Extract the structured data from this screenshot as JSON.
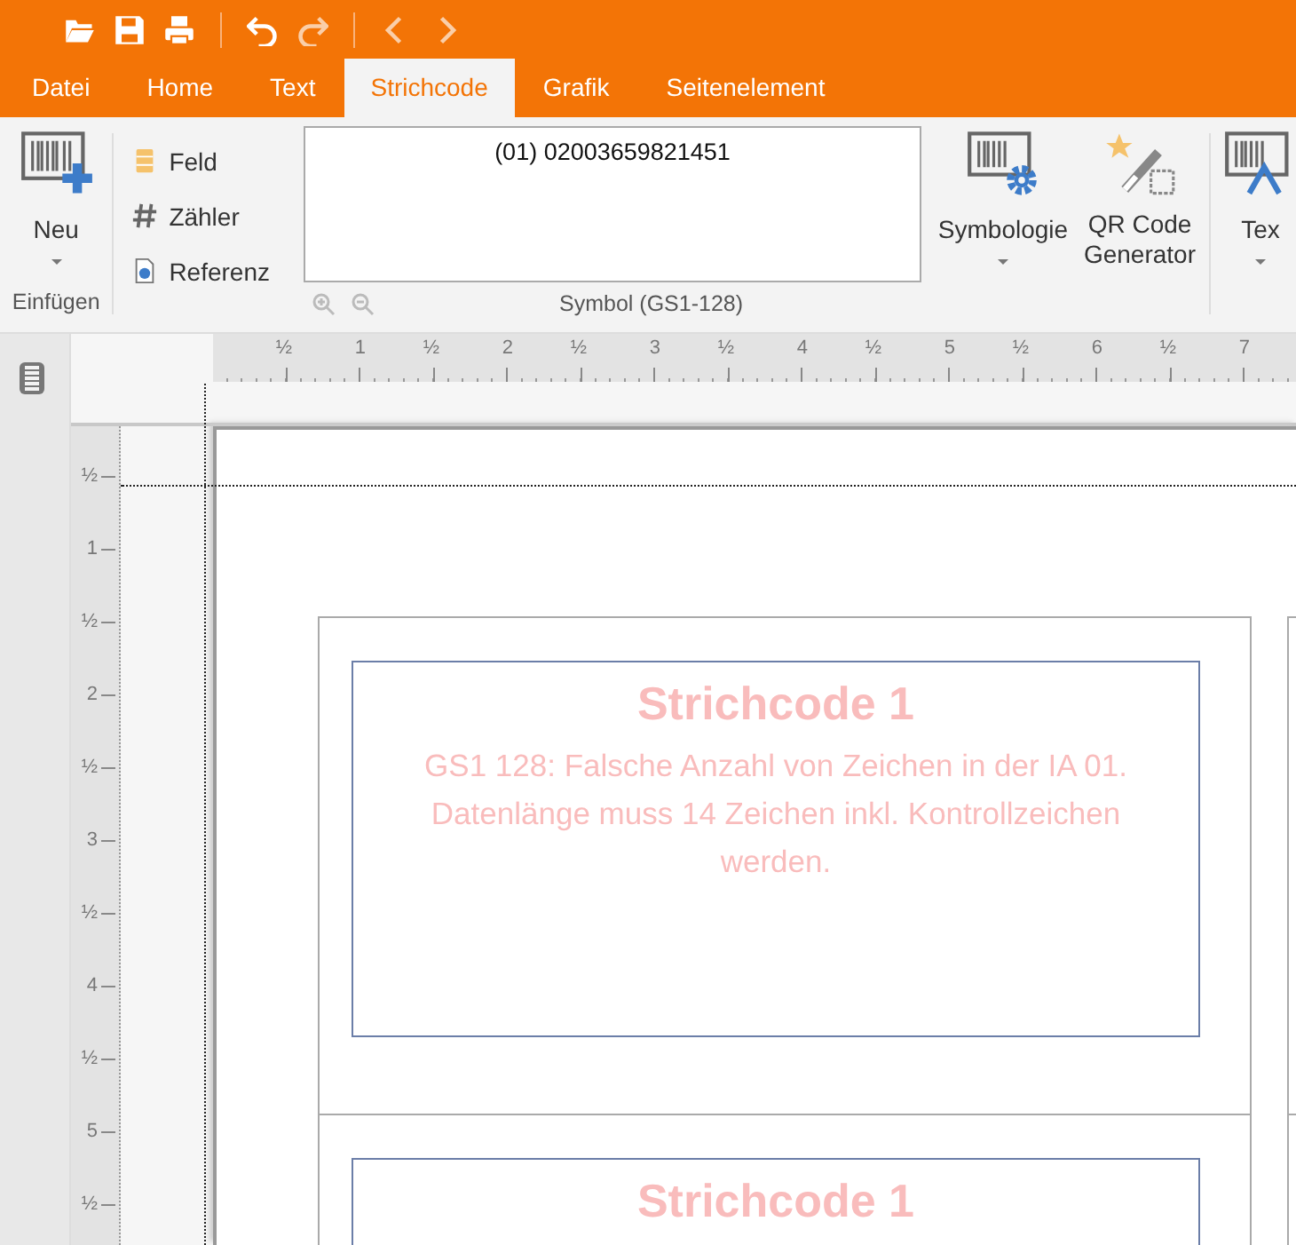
{
  "tabs": [
    {
      "label": "Datei",
      "selected": false
    },
    {
      "label": "Home",
      "selected": false
    },
    {
      "label": "Text",
      "selected": false
    },
    {
      "label": "Strichcode",
      "selected": true
    },
    {
      "label": "Grafik",
      "selected": false
    },
    {
      "label": "Seitenelement",
      "selected": false
    }
  ],
  "ribbon": {
    "new_button": "Neu",
    "insert_group": "Einfügen",
    "list_items": [
      {
        "kind": "field",
        "label": "Feld"
      },
      {
        "kind": "counter",
        "label": "Zähler"
      },
      {
        "kind": "reference",
        "label": "Referenz"
      }
    ],
    "symbol_value": "(01) 02003659821451",
    "symbol_group": "Symbol (GS1-128)",
    "symbology_button": "Symbologie",
    "qr_button": [
      "QR Code",
      "Generator"
    ],
    "text_button": "Tex"
  },
  "ruler_h": [
    "½",
    "1",
    "½",
    "2",
    "½",
    "3",
    "½",
    "4",
    "½",
    "5",
    "½",
    "6",
    "½",
    "7"
  ],
  "ruler_v": [
    "½",
    "1",
    "½",
    "2",
    "½",
    "3",
    "½",
    "4",
    "½",
    "5",
    "½"
  ],
  "labels": [
    {
      "title": "Strichcode 1",
      "message": [
        "GS1 128: Falsche Anzahl von Zeichen in der IA 01.",
        "Datenlänge muss 14 Zeichen inkl. Kontrollzeichen",
        "werden."
      ]
    },
    {
      "title": "Strichcode 1"
    }
  ]
}
